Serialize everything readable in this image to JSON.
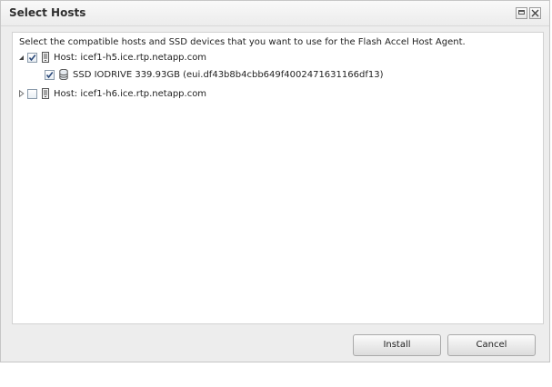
{
  "dialog": {
    "title": "Select Hosts",
    "instruction": "Select the compatible hosts and SSD devices that you want to use for the Flash Accel Host Agent."
  },
  "tree": {
    "hosts": [
      {
        "label": "Host: icef1-h5.ice.rtp.netapp.com",
        "expanded": true,
        "checked": true,
        "icon": "server-icon",
        "devices": [
          {
            "label": "SSD IODRIVE 339.93GB (eui.df43b8b4cbb649f4002471631166df13)",
            "checked": true,
            "icon": "ssd-icon"
          }
        ]
      },
      {
        "label": "Host: icef1-h6.ice.rtp.netapp.com",
        "expanded": false,
        "checked": false,
        "icon": "server-icon",
        "devices": []
      }
    ]
  },
  "buttons": {
    "install": "Install",
    "cancel": "Cancel"
  }
}
